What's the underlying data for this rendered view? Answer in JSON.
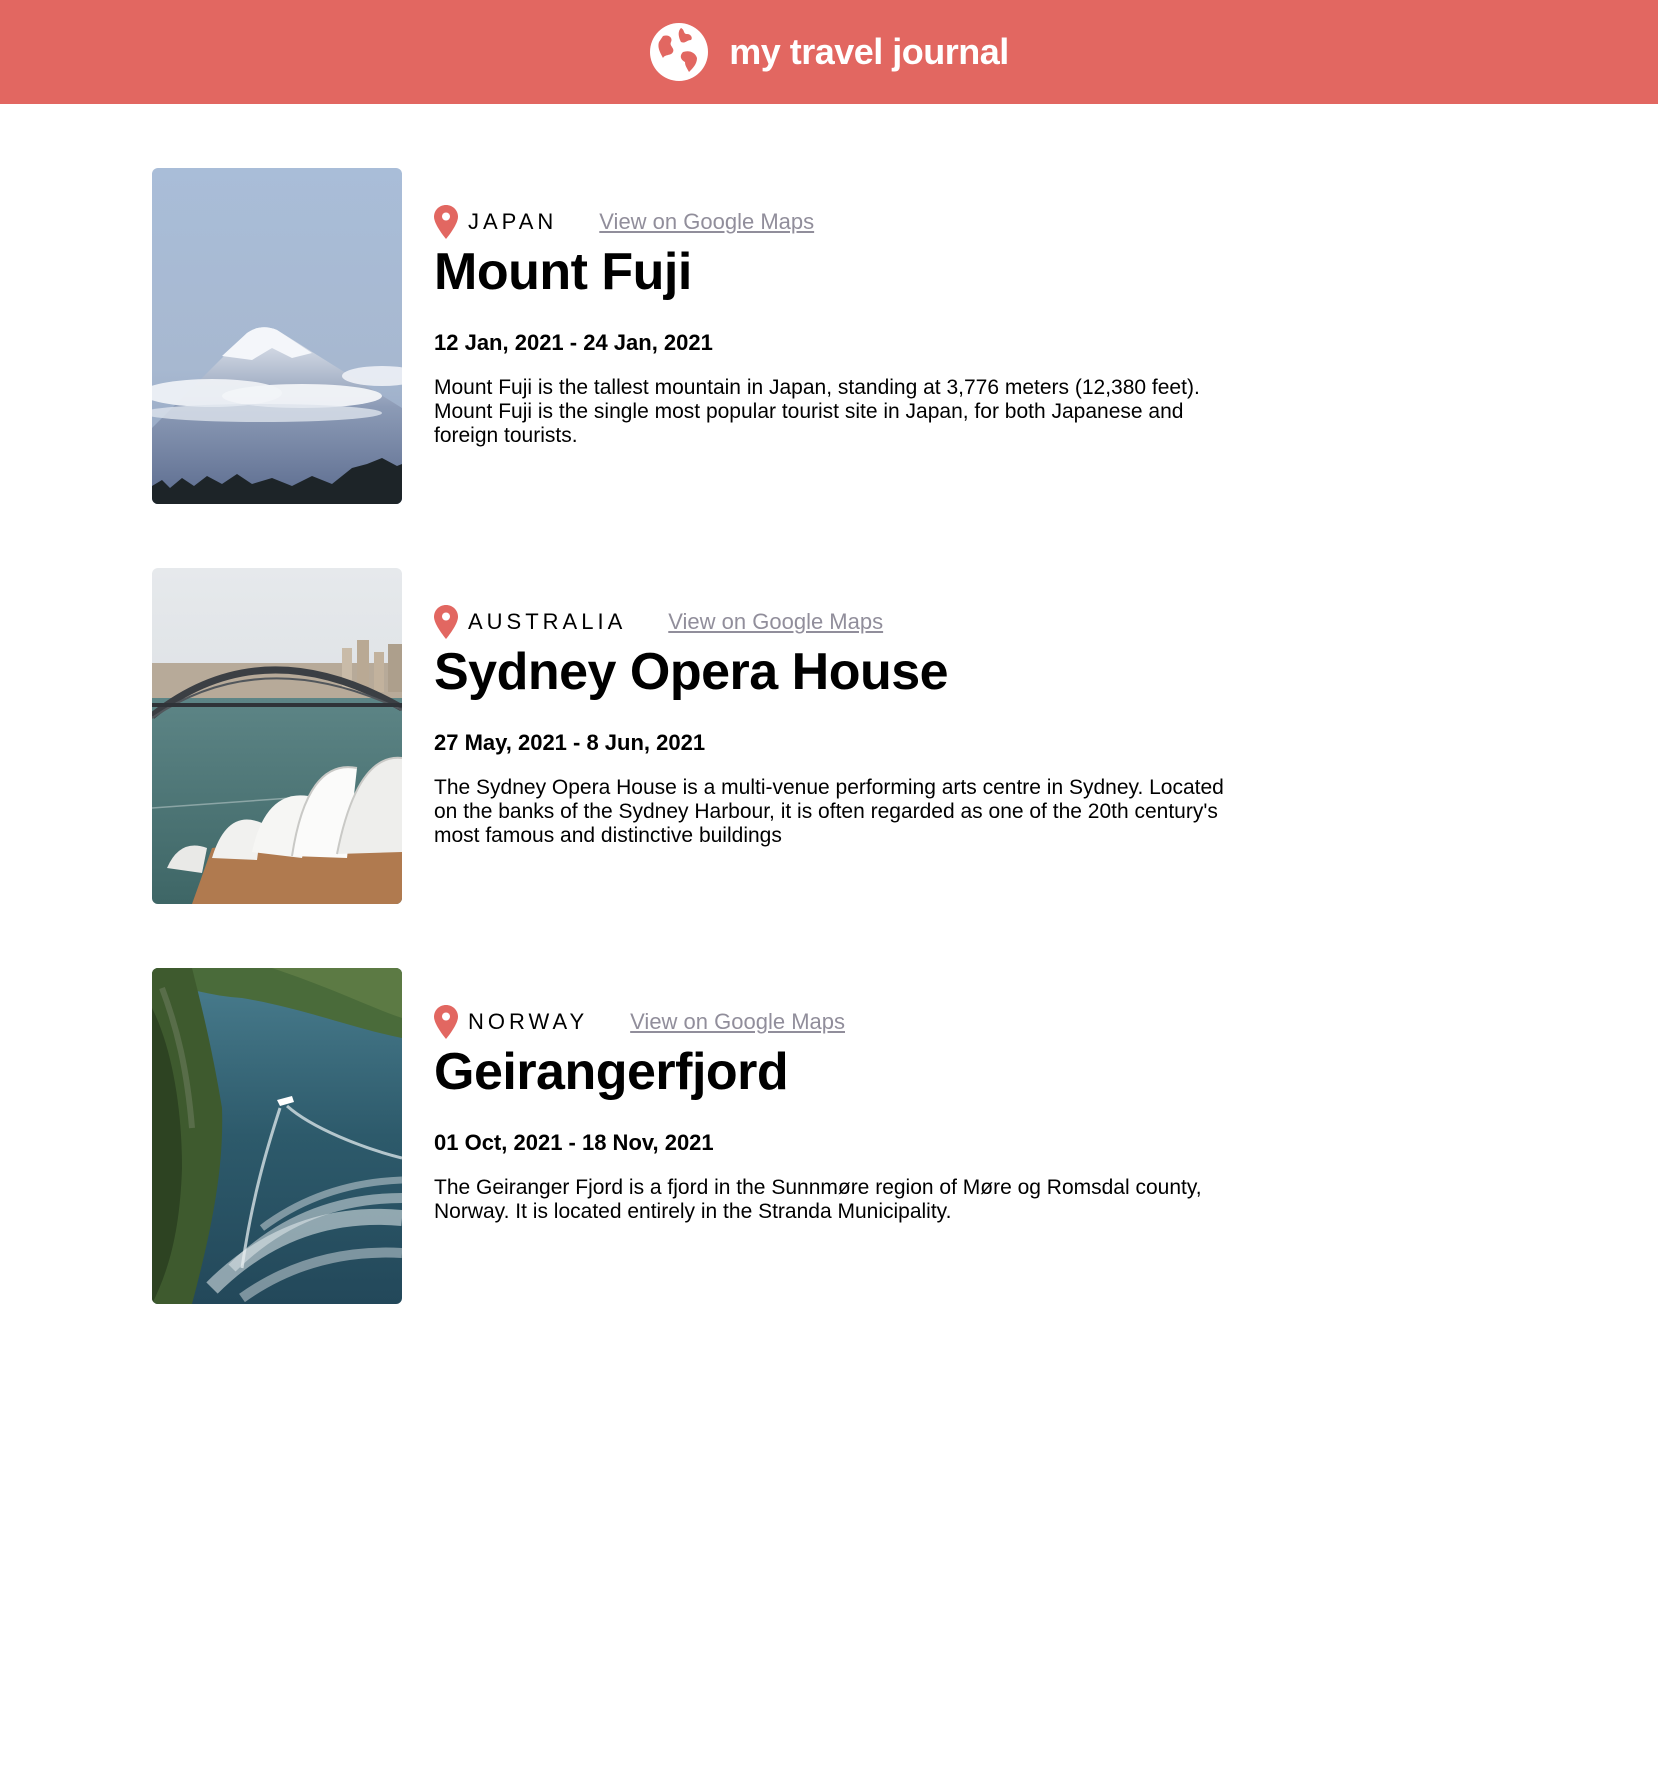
{
  "header": {
    "brand": "my travel journal",
    "bg_color": "#e26761",
    "logo_icon": "globe-icon"
  },
  "entries": [
    {
      "country": "JAPAN",
      "maps_label": "View on Google Maps",
      "title": "Mount Fuji",
      "dates": "12 Jan, 2021 - 24 Jan, 2021",
      "description": "Mount Fuji is the tallest mountain in Japan, standing at 3,776 meters (12,380 feet). Mount Fuji is the single most popular tourist site in Japan, for both Japanese and foreign tourists."
    },
    {
      "country": "AUSTRALIA",
      "maps_label": "View on Google Maps",
      "title": "Sydney Opera House",
      "dates": "27 May, 2021 - 8 Jun, 2021",
      "description": "The Sydney Opera House is a multi-venue performing arts centre in Sydney. Located on the banks of the Sydney Harbour, it is often regarded as one of the 20th century's most famous and distinctive buildings"
    },
    {
      "country": "NORWAY",
      "maps_label": "View on Google Maps",
      "title": "Geirangerfjord",
      "dates": "01 Oct, 2021 - 18 Nov, 2021",
      "description": "The Geiranger Fjord is a fjord in the Sunnmøre region of Møre og Romsdal county, Norway. It is located entirely in the Stranda Municipality."
    }
  ],
  "colors": {
    "accent": "#e26761",
    "link": "#918e9b",
    "text": "#000000"
  }
}
